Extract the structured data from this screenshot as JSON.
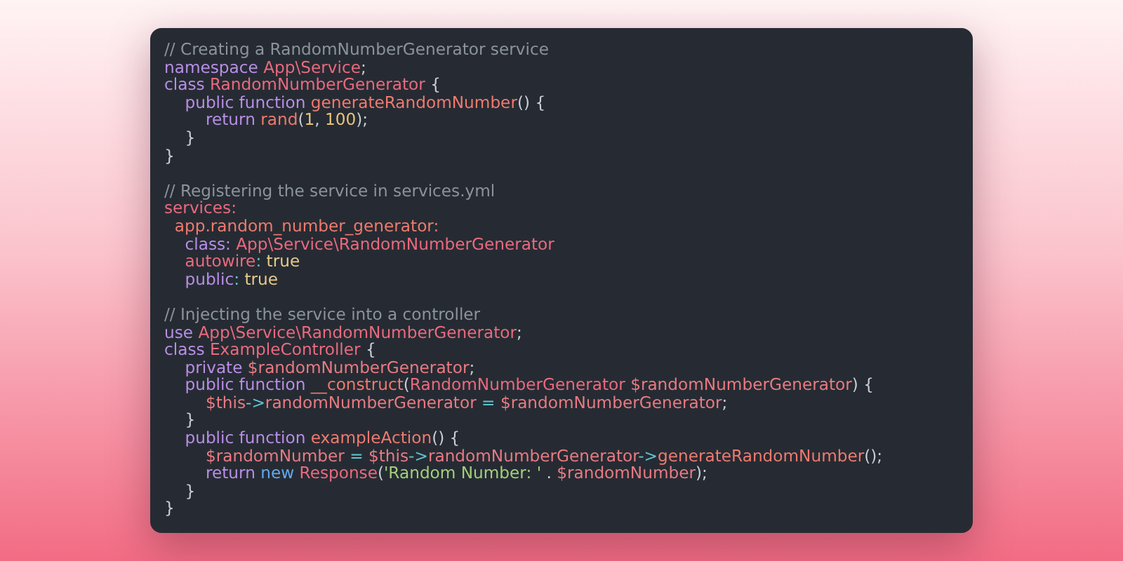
{
  "code_window": {
    "blocks": [
      {
        "lines": [
          [
            {
              "kind": "comment",
              "text": "// Creating a RandomNumberGenerator service"
            }
          ],
          [
            {
              "kind": "keyword",
              "text": "namespace "
            },
            {
              "kind": "type",
              "text": "App\\Service"
            },
            {
              "kind": "punct",
              "text": ";"
            }
          ],
          [
            {
              "kind": "keyword",
              "text": "class "
            },
            {
              "kind": "type",
              "text": "RandomNumberGenerator"
            },
            {
              "kind": "punct",
              "text": " {"
            }
          ],
          [
            {
              "kind": "keyword",
              "text": "    public function "
            },
            {
              "kind": "func",
              "text": "generateRandomNumber"
            },
            {
              "kind": "punct",
              "text": "() {"
            }
          ],
          [
            {
              "kind": "keyword",
              "text": "        return "
            },
            {
              "kind": "func",
              "text": "rand"
            },
            {
              "kind": "punct",
              "text": "("
            },
            {
              "kind": "number",
              "text": "1"
            },
            {
              "kind": "punct",
              "text": ", "
            },
            {
              "kind": "number",
              "text": "100"
            },
            {
              "kind": "punct",
              "text": ");"
            }
          ],
          [
            {
              "kind": "punct",
              "text": "    }"
            }
          ],
          [
            {
              "kind": "punct",
              "text": "}"
            }
          ]
        ]
      },
      {
        "lines": [
          [
            {
              "kind": "comment",
              "text": "// Registering the service in services.yml"
            }
          ],
          [
            {
              "kind": "type",
              "text": "services:"
            }
          ],
          [
            {
              "kind": "func",
              "text": "  app.random_number_generator:"
            }
          ],
          [
            {
              "kind": "keyword",
              "text": "    class: "
            },
            {
              "kind": "type",
              "text": "App\\Service\\RandomNumberGenerator"
            }
          ],
          [
            {
              "kind": "type",
              "text": "    autowire"
            },
            {
              "kind": "op",
              "text": ": "
            },
            {
              "kind": "constant",
              "text": "true"
            }
          ],
          [
            {
              "kind": "keyword",
              "text": "    public"
            },
            {
              "kind": "op",
              "text": ": "
            },
            {
              "kind": "constant",
              "text": "true"
            }
          ]
        ]
      },
      {
        "lines": [
          [
            {
              "kind": "comment",
              "text": "// Injecting the service into a controller"
            }
          ],
          [
            {
              "kind": "keyword",
              "text": "use "
            },
            {
              "kind": "type",
              "text": "App\\Service\\RandomNumberGenerator"
            },
            {
              "kind": "punct",
              "text": ";"
            }
          ],
          [
            {
              "kind": "keyword",
              "text": "class "
            },
            {
              "kind": "type",
              "text": "ExampleController"
            },
            {
              "kind": "punct",
              "text": " {"
            }
          ],
          [
            {
              "kind": "keyword",
              "text": "    private "
            },
            {
              "kind": "var",
              "text": "$randomNumberGenerator"
            },
            {
              "kind": "punct",
              "text": ";"
            }
          ],
          [
            {
              "kind": "keyword",
              "text": "    public function "
            },
            {
              "kind": "func",
              "text": "__construct"
            },
            {
              "kind": "punct",
              "text": "("
            },
            {
              "kind": "type",
              "text": "RandomNumberGenerator "
            },
            {
              "kind": "var",
              "text": "$randomNumberGenerator"
            },
            {
              "kind": "punct",
              "text": ") {"
            }
          ],
          [
            {
              "kind": "var",
              "text": "        $this"
            },
            {
              "kind": "op",
              "text": "->"
            },
            {
              "kind": "var",
              "text": "randomNumberGenerator"
            },
            {
              "kind": "op",
              "text": " = "
            },
            {
              "kind": "var",
              "text": "$randomNumberGenerator"
            },
            {
              "kind": "punct",
              "text": ";"
            }
          ],
          [
            {
              "kind": "punct",
              "text": "    }"
            }
          ],
          [
            {
              "kind": "keyword",
              "text": "    public function "
            },
            {
              "kind": "func",
              "text": "exampleAction"
            },
            {
              "kind": "punct",
              "text": "() {"
            }
          ],
          [
            {
              "kind": "var",
              "text": "        $randomNumber"
            },
            {
              "kind": "op",
              "text": " = "
            },
            {
              "kind": "var",
              "text": "$this"
            },
            {
              "kind": "op",
              "text": "->"
            },
            {
              "kind": "var",
              "text": "randomNumberGenerator"
            },
            {
              "kind": "op",
              "text": "->"
            },
            {
              "kind": "func",
              "text": "generateRandomNumber"
            },
            {
              "kind": "punct",
              "text": "();"
            }
          ],
          [
            {
              "kind": "keyword",
              "text": "        return "
            },
            {
              "kind": "new",
              "text": "new "
            },
            {
              "kind": "type",
              "text": "Response"
            },
            {
              "kind": "punct",
              "text": "("
            },
            {
              "kind": "string",
              "text": "'Random Number: '"
            },
            {
              "kind": "punct",
              "text": " . "
            },
            {
              "kind": "var",
              "text": "$randomNumber"
            },
            {
              "kind": "punct",
              "text": ");"
            }
          ],
          [
            {
              "kind": "punct",
              "text": "    }"
            }
          ],
          [
            {
              "kind": "punct",
              "text": "}"
            }
          ]
        ]
      }
    ]
  }
}
